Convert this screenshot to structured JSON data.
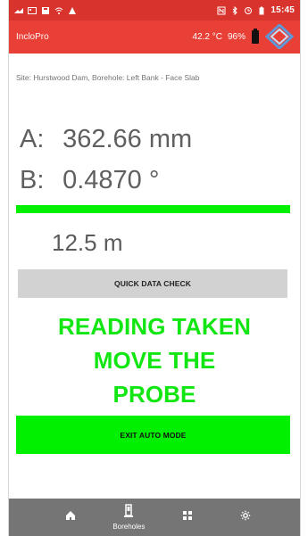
{
  "status_bar": {
    "time": "15:45",
    "icons": [
      "signal-icon",
      "gallery-icon",
      "save-icon",
      "wifi-icon",
      "warning-icon",
      "nfc-icon",
      "bluetooth-icon",
      "alarm-icon",
      "battery-status-icon"
    ]
  },
  "header": {
    "title": "IncloPro",
    "temperature": "42.2 °C",
    "battery_percent": "96%",
    "logo": "diamond-logo-icon"
  },
  "site": {
    "text": "Site: Hurstwood Dam, Borehole: Left Bank - Face Slab"
  },
  "readings": {
    "a_label": "A:",
    "a_value": "362.66 mm",
    "b_label": "B:",
    "b_value": "0.4870 °"
  },
  "depth": {
    "value": "12.5 m"
  },
  "buttons": {
    "quick_data_check": "QUICK DATA CHECK",
    "exit_auto_mode": "EXIT AUTO MODE"
  },
  "message": {
    "line1": "READING TAKEN",
    "line2": "MOVE THE",
    "line3": "PROBE"
  },
  "bottom_nav": {
    "home": "",
    "boreholes": "Boreholes",
    "grid": "",
    "settings": ""
  },
  "colors": {
    "status_bar": "#d8332c",
    "header": "#e83f36",
    "accent_green": "#00f000",
    "message_green": "#12e612",
    "button_gray": "#d2d2d2",
    "nav_gray": "#757575"
  }
}
